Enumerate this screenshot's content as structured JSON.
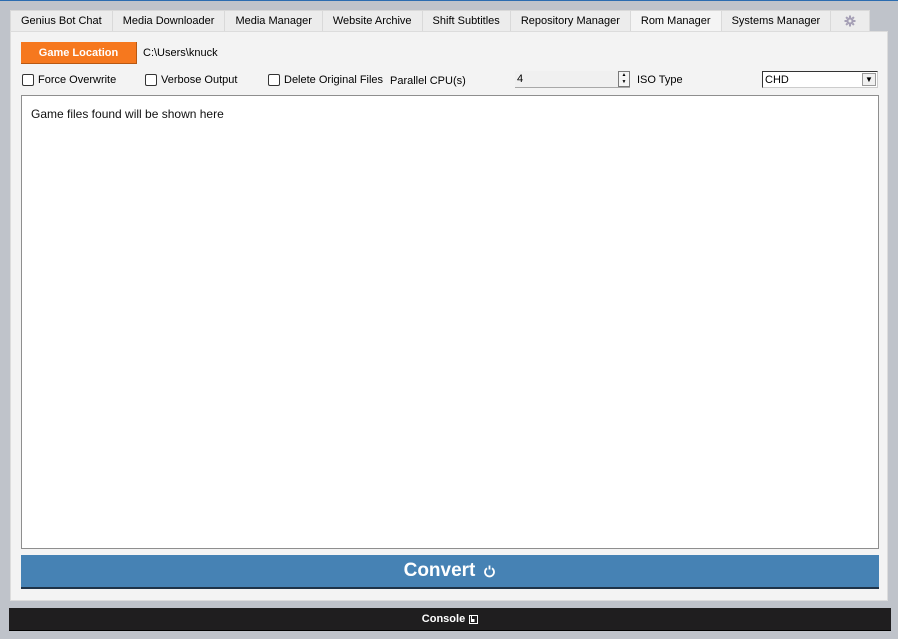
{
  "tabs": [
    {
      "label": "Genius Bot Chat",
      "active": false
    },
    {
      "label": "Media Downloader",
      "active": false
    },
    {
      "label": "Media Manager",
      "active": false
    },
    {
      "label": "Website Archive",
      "active": false
    },
    {
      "label": "Shift Subtitles",
      "active": false
    },
    {
      "label": "Repository Manager",
      "active": false
    },
    {
      "label": "Rom Manager",
      "active": true
    },
    {
      "label": "Systems Manager",
      "active": false
    }
  ],
  "settings_tab_icon": "gear-icon",
  "rom_manager": {
    "game_location_label": "Game Location",
    "game_location_path": "C:\\Users\\knuck",
    "options": {
      "force_overwrite": {
        "label": "Force Overwrite",
        "checked": false
      },
      "verbose_output": {
        "label": "Verbose Output",
        "checked": false
      },
      "delete_original_files": {
        "label": "Delete Original Files",
        "checked": false
      }
    },
    "parallel_cpu_label": "Parallel CPU(s)",
    "parallel_cpu_value": "4",
    "iso_type_label": "ISO Type",
    "iso_type_value": "CHD",
    "output_placeholder": "Game files found will be shown here",
    "convert_label": "Convert",
    "convert_icon": "power-icon"
  },
  "console": {
    "label": "Console",
    "icon": "popout-icon"
  },
  "colors": {
    "accent_orange": "#f6781e",
    "convert_blue": "#4682b4",
    "console_bg": "#1f1e1f"
  }
}
